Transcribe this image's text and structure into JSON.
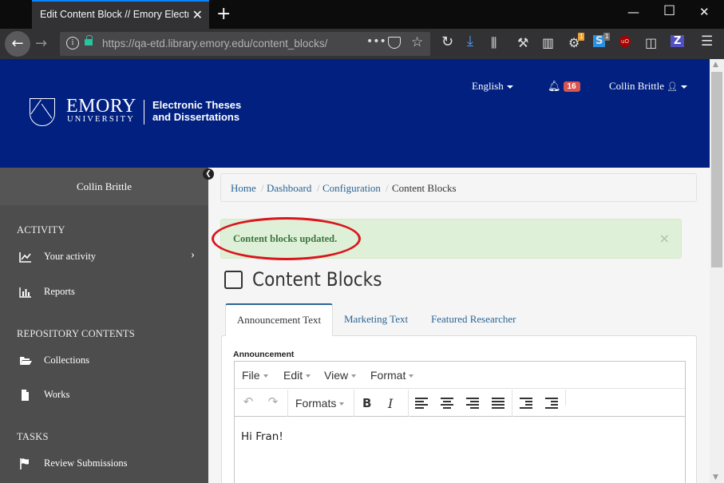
{
  "browser": {
    "tab_title": "Edit Content Block // Emory Electronic Theses and Dissertations",
    "url": "https://qa-etd.library.emory.edu/content_blocks/",
    "new_tab": "+",
    "ext_badge_1": "1",
    "ext_badge_2": "1",
    "ext_z": "Z",
    "ext_s": "S"
  },
  "header": {
    "logo_name": "EMORY",
    "logo_univ": "UNIVERSITY",
    "logo_etd_line1": "Electronic Theses",
    "logo_etd_line2": "and Dissertations",
    "language": "English",
    "notifications": "16",
    "user": "Collin Brittle"
  },
  "sidebar": {
    "user": "Collin Brittle",
    "heading_activity": "ACTIVITY",
    "item_your_activity": "Your activity",
    "item_reports": "Reports",
    "heading_repository": "REPOSITORY CONTENTS",
    "item_collections": "Collections",
    "item_works": "Works",
    "heading_tasks": "TASKS",
    "item_review": "Review Submissions"
  },
  "breadcrumb": {
    "home": "Home",
    "dashboard": "Dashboard",
    "configuration": "Configuration",
    "current": "Content Blocks",
    "sep": "/"
  },
  "alert": {
    "message": "Content blocks updated.",
    "close": "×"
  },
  "main": {
    "title": "Content Blocks",
    "tabs": [
      "Announcement Text",
      "Marketing Text",
      "Featured Researcher"
    ],
    "field_label": "Announcement"
  },
  "editor": {
    "menus": [
      "File",
      "Edit",
      "View",
      "Format"
    ],
    "formats_label": "Formats",
    "bold": "B",
    "italic": "I",
    "content": "Hi Fran!"
  },
  "colors": {
    "header_bg": "#012080",
    "sidebar_bg": "#4d4d4d",
    "alert_bg": "#dff0d8",
    "alert_text": "#3c763d",
    "link": "#2a6496",
    "annotation_circle": "#d9161c",
    "badge": "#d9534f"
  }
}
